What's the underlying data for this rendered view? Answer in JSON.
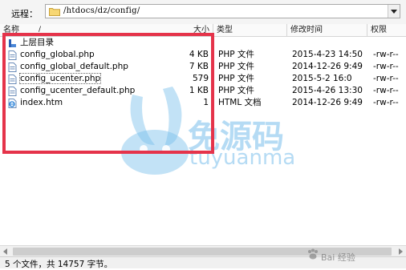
{
  "pathbar": {
    "label": "远程：",
    "path": "/htdocs/dz/config/"
  },
  "header": {
    "name": "名称",
    "sort_indicator": "/",
    "size": "大小",
    "type": "类型",
    "modified": "修改时间",
    "permissions": "权限"
  },
  "rows": [
    {
      "icon": "parent-folder-icon",
      "name": "上层目录",
      "size": "",
      "type": "",
      "modified": "",
      "perm": ""
    },
    {
      "icon": "php-file-icon",
      "name": "config_global.php",
      "size": "4 KB",
      "type": "PHP 文件",
      "modified": "2015-4-23 14:50",
      "perm": "-rw-r--"
    },
    {
      "icon": "php-file-icon",
      "name": "config_global_default.php",
      "size": "7 KB",
      "type": "PHP 文件",
      "modified": "2014-12-26 9:49",
      "perm": "-rw-r--"
    },
    {
      "icon": "php-file-icon",
      "name": "config_ucenter.php",
      "size": "579",
      "type": "PHP 文件",
      "modified": "2015-5-2 16:0",
      "perm": "-rw-r--"
    },
    {
      "icon": "php-file-icon",
      "name": "config_ucenter_default.php",
      "size": "1 KB",
      "type": "PHP 文件",
      "modified": "2015-4-26 13:30",
      "perm": "-rw-r--"
    },
    {
      "icon": "html-file-icon",
      "name": "index.htm",
      "size": "1",
      "type": "HTML 文档",
      "modified": "2014-12-26 9:49",
      "perm": "-rw-r--"
    }
  ],
  "status": {
    "text": "5 个文件，共 14757 字节。"
  },
  "watermark": {
    "cn": "免源码",
    "en": "tuyuanma",
    "corner": "Bai 经验"
  },
  "colors": {
    "highlight": "#e5334a",
    "watermark": "#78bee b"
  }
}
